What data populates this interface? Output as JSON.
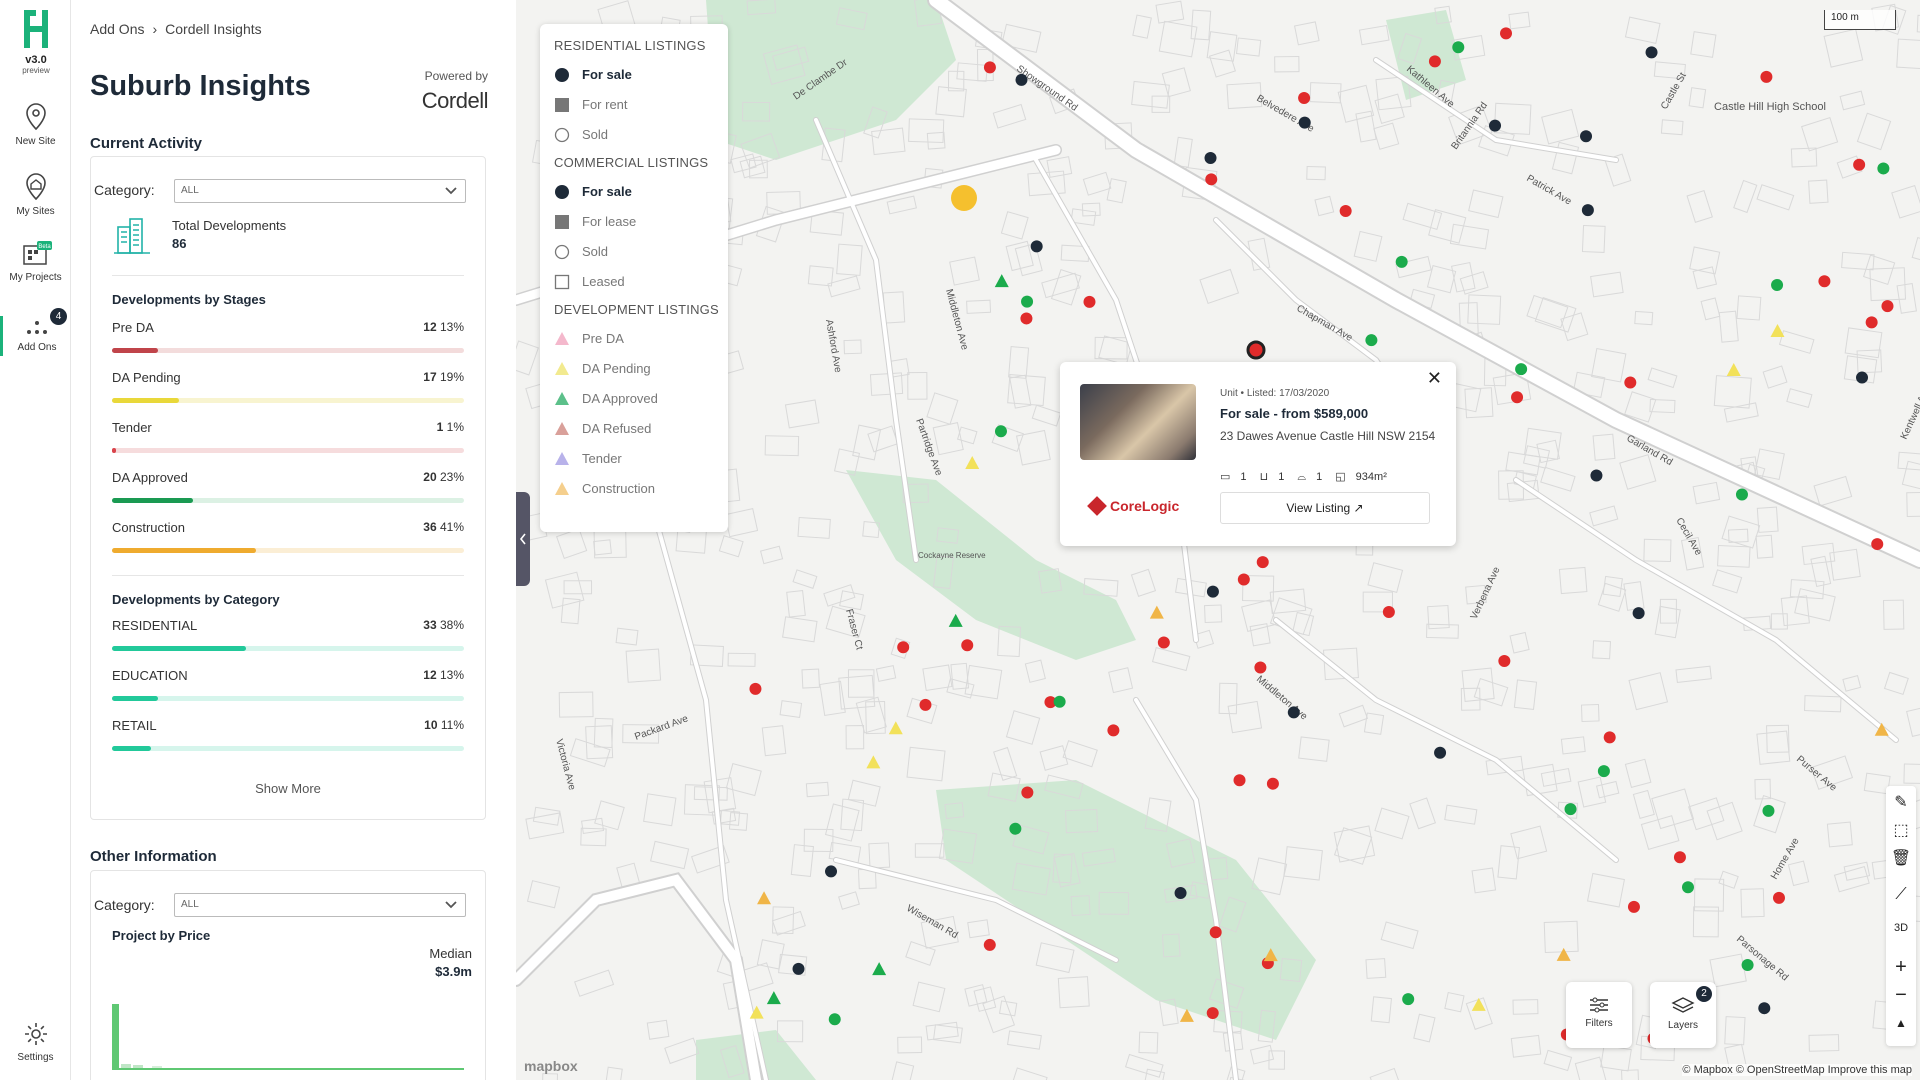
{
  "rail": {
    "version": "v3.0",
    "version_sub": "preview",
    "items": [
      {
        "label": "New Site",
        "icon": "location-pin-icon"
      },
      {
        "label": "My Sites",
        "icon": "home-location-icon"
      },
      {
        "label": "My Projects",
        "icon": "projects-icon",
        "badge": "Beta"
      },
      {
        "label": "Add Ons",
        "icon": "add-ons-dots-icon",
        "badge": "4"
      },
      {
        "label": "Settings",
        "icon": "gear-icon"
      }
    ]
  },
  "panel": {
    "breadcrumb": [
      "Add Ons",
      "Cordell Insights"
    ],
    "title": "Suburb Insights",
    "powered_by": "Powered by",
    "brand": "Cordell",
    "current_activity": {
      "heading": "Current Activity",
      "category_label": "Category:",
      "category_value": "ALL",
      "total_label": "Total Developments",
      "total_value": "86",
      "stages_heading": "Developments by Stages",
      "stages": [
        {
          "name": "Pre DA",
          "count": "12",
          "pct": "13%",
          "fraction": 0.13,
          "color": "#c0444a",
          "track": "#f3dcdc"
        },
        {
          "name": "DA Pending",
          "count": "17",
          "pct": "19%",
          "fraction": 0.19,
          "color": "#e9d83a",
          "track": "#f8f4d0"
        },
        {
          "name": "Tender",
          "count": "1",
          "pct": "1%",
          "fraction": 0.01,
          "color": "#d9434b",
          "track": "#f6dcdd"
        },
        {
          "name": "DA Approved",
          "count": "20",
          "pct": "23%",
          "fraction": 0.23,
          "color": "#1a9a52",
          "track": "#dcf1e4"
        },
        {
          "name": "Construction",
          "count": "36",
          "pct": "41%",
          "fraction": 0.41,
          "color": "#efab2f",
          "track": "#fbeed5"
        }
      ],
      "category_heading": "Developments by Category",
      "categories": [
        {
          "name": "RESIDENTIAL",
          "count": "33",
          "pct": "38%",
          "fraction": 0.38,
          "color": "#22c99a",
          "track": "#d6f5ec"
        },
        {
          "name": "EDUCATION",
          "count": "12",
          "pct": "13%",
          "fraction": 0.13,
          "color": "#22c99a",
          "track": "#d6f5ec"
        },
        {
          "name": "RETAIL",
          "count": "10",
          "pct": "11%",
          "fraction": 0.11,
          "color": "#22c99a",
          "track": "#d6f5ec"
        }
      ],
      "show_more": "Show More"
    },
    "other_info": {
      "heading": "Other Information",
      "category_label": "Category:",
      "category_value": "ALL",
      "price_heading": "Project by Price",
      "median_label": "Median",
      "median_value": "$3.9m"
    }
  },
  "legend": {
    "residential_heading": "RESIDENTIAL LISTINGS",
    "residential": [
      {
        "label": "For sale",
        "symbol": "filled-circle",
        "color": "#1e2a38",
        "active": true
      },
      {
        "label": "For rent",
        "symbol": "filled-square",
        "color": "#777",
        "active": false
      },
      {
        "label": "Sold",
        "symbol": "hollow-circle",
        "color": "#777",
        "active": false
      }
    ],
    "commercial_heading": "COMMERCIAL LISTINGS",
    "commercial": [
      {
        "label": "For sale",
        "symbol": "filled-circle",
        "color": "#1e2a38",
        "active": true
      },
      {
        "label": "For lease",
        "symbol": "filled-square",
        "color": "#777",
        "active": false
      },
      {
        "label": "Sold",
        "symbol": "hollow-circle",
        "color": "#777",
        "active": false
      },
      {
        "label": "Leased",
        "symbol": "hollow-square",
        "color": "#777",
        "active": false
      }
    ],
    "development_heading": "DEVELOPMENT LISTINGS",
    "development": [
      {
        "label": "Pre DA",
        "color": "#f4b8cc"
      },
      {
        "label": "DA Pending",
        "color": "#f2ea8f"
      },
      {
        "label": "DA Approved",
        "color": "#5cc08a"
      },
      {
        "label": "DA Refused",
        "color": "#d9a09a"
      },
      {
        "label": "Tender",
        "color": "#b8b2ea"
      },
      {
        "label": "Construction",
        "color": "#f5cf8d"
      }
    ]
  },
  "popup": {
    "meta": "Unit • Listed: 17/03/2020",
    "title": "For sale - from $589,000",
    "address": "23 Dawes Avenue Castle Hill NSW 2154",
    "beds": "1",
    "baths": "1",
    "cars": "1",
    "area": "934m²",
    "brand": "CoreLogic",
    "button": "View Listing"
  },
  "map": {
    "scale": "100 m",
    "streets": [
      "Showground Rd",
      "De Clambe Dr",
      "Belvedere Ave",
      "Kathleen Ave",
      "Britannia Rd",
      "Patrick Ave",
      "Castle St",
      "Chapman Ave",
      "Middleton Ave",
      "Ashford Ave",
      "Partridge Ave",
      "Cecil Ave",
      "Victoria Ave",
      "Packard Ave",
      "Fraser Ct",
      "Middleton Ave",
      "Verbena Ave",
      "Wiseman Rd",
      "Purser Ave",
      "Parsonage Rd",
      "Kentwell Ave",
      "Home Ave",
      "Garland Rd"
    ],
    "poi": "Castle Hill High School",
    "reserve": "Cockayne Reserve",
    "filters_label": "Filters",
    "layers_label": "Layers",
    "layers_badge": "2",
    "attribution": "© Mapbox © OpenStreetMap  Improve this map",
    "mapbox_logo": "mapbox",
    "tools": [
      "pencil-icon",
      "polygon-icon",
      "trash-icon",
      "ruler-icon",
      "3d-icon",
      "zoom-in-icon",
      "zoom-out-icon",
      "compass-icon"
    ],
    "tool_labels": {
      "3d": "3D",
      "zoom_in": "+",
      "zoom_out": "−",
      "compass": "▲"
    }
  }
}
